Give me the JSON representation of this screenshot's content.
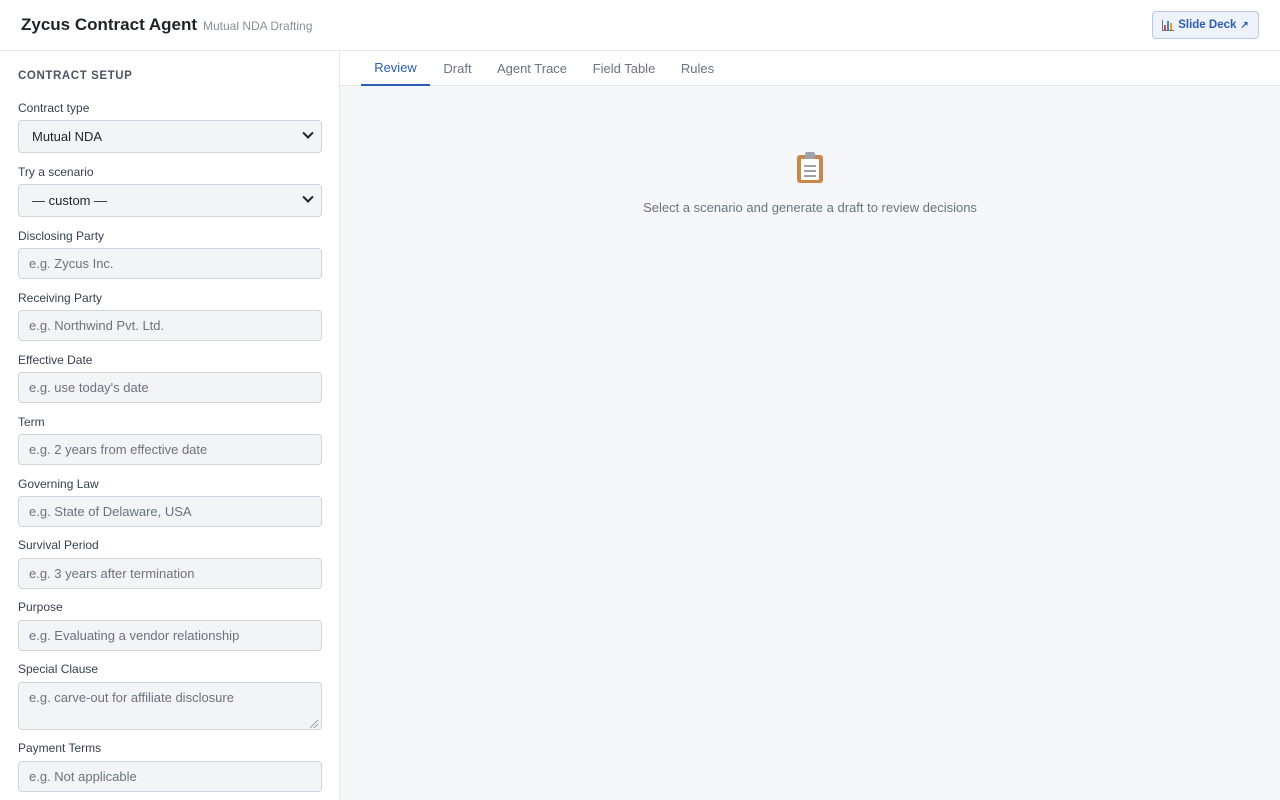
{
  "header": {
    "title": "Zycus Contract Agent",
    "subtitle": "Mutual NDA Drafting",
    "deck_button": {
      "label": "Slide Deck",
      "arrow": "↗",
      "icon": "bar-chart-icon"
    }
  },
  "sidebar": {
    "heading": "CONTRACT SETUP",
    "contract_type": {
      "label": "Contract type",
      "value": "Mutual NDA"
    },
    "scenario": {
      "label": "Try a scenario",
      "value": "— custom —"
    },
    "fields": {
      "disclosing_party": {
        "label": "Disclosing Party",
        "placeholder": "e.g. Zycus Inc."
      },
      "receiving_party": {
        "label": "Receiving Party",
        "placeholder": "e.g. Northwind Pvt. Ltd."
      },
      "effective_date": {
        "label": "Effective Date",
        "placeholder": "e.g. use today's date"
      },
      "term": {
        "label": "Term",
        "placeholder": "e.g. 2 years from effective date"
      },
      "governing_law": {
        "label": "Governing Law",
        "placeholder": "e.g. State of Delaware, USA"
      },
      "survival_period": {
        "label": "Survival Period",
        "placeholder": "e.g. 3 years after termination"
      },
      "purpose": {
        "label": "Purpose",
        "placeholder": "e.g. Evaluating a vendor relationship"
      },
      "special_clause": {
        "label": "Special Clause",
        "placeholder": "e.g. carve-out for affiliate disclosure"
      },
      "payment_terms": {
        "label": "Payment Terms",
        "placeholder": "e.g. Not applicable"
      }
    }
  },
  "main": {
    "tabs": [
      {
        "label": "Review",
        "active": true
      },
      {
        "label": "Draft",
        "active": false
      },
      {
        "label": "Agent Trace",
        "active": false
      },
      {
        "label": "Field Table",
        "active": false
      },
      {
        "label": "Rules",
        "active": false
      }
    ],
    "empty_state": {
      "icon": "clipboard-icon",
      "message": "Select a scenario and generate a draft to review decisions"
    }
  },
  "colors": {
    "accent": "#2b5cb8",
    "border": "#e5e7eb",
    "input_bg": "#f3f4f6",
    "main_bg": "#f6f7f9"
  }
}
